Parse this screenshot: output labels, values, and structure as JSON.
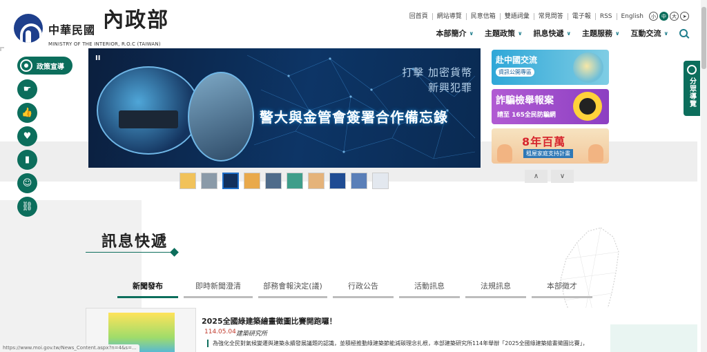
{
  "header": {
    "logo_cn": "中華民國",
    "logo_brush": "內政部",
    "logo_en": "MINISTRY OF THE INTERIOR, R.O.C (TAIWAN)",
    "top_links": [
      "回首頁",
      "網站導覽",
      "民意信箱",
      "雙語詞彙",
      "常見問答",
      "電子報",
      "RSS",
      "English"
    ],
    "font_sizes": [
      "小",
      "中",
      "大"
    ],
    "nav": [
      "本部簡介",
      "主題政策",
      "訊息快遞",
      "主題服務",
      "互動交流"
    ]
  },
  "side": {
    "policy_label": "政策宣導",
    "guide_label": "分眾導覽"
  },
  "hero": {
    "pause": "II",
    "sub": "打擊 加密貨幣\n新興犯罪",
    "headline": "警大與金管會簽署合作備忘錄"
  },
  "ads": {
    "ad1_title": "赴中國交流",
    "ad1_sub": "資訊公開專區",
    "ad2_title": "詐騙檢舉報案",
    "ad2_sub": "請至 165全民防騙網",
    "ad3_title": "8年百萬",
    "ad3_sub": "租屋家庭支持計畫"
  },
  "news": {
    "section_title": "訊息快遞",
    "tabs": [
      "新聞發布",
      "即時新聞澄清",
      "部務會報決定(議)",
      "行政公告",
      "活動訊息",
      "法規訊息",
      "本部徵才"
    ],
    "item": {
      "title": "2025全國綠建築繪畫徵圖比賽開跑囉！",
      "date": "114.05.04",
      "org": "建築研究所",
      "desc": "為強化全民對氣候變遷與建築永續發展議題的認識，並積極推動綠建築節能減碳理念扎根，本部建築研究所114年舉辦「2025全國綠建築繪畫徵圖比賽」，"
    }
  },
  "status_url": "https://www.moi.gov.tw/News_Content.aspx?n=4&s=..."
}
